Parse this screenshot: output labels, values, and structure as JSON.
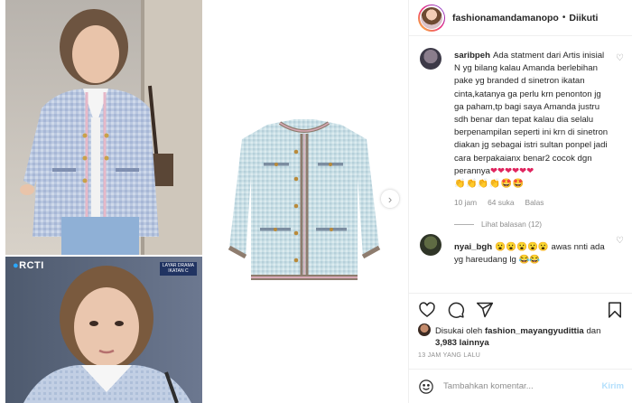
{
  "post": {
    "username": "fashionamandamanopo",
    "separator": "•",
    "follow_status": "Diikuti"
  },
  "media": {
    "channel_logo": "RCTI",
    "show_tag_line1": "LAYAR DRAMA",
    "show_tag_line2": "IKATAN C",
    "next_icon": "chevron-right-icon"
  },
  "comments": [
    {
      "username": "saribpeh",
      "text": "Ada statment dari Artis inisial N yg bilang kalau Amanda berlebihan pake yg branded d sinetron ikatan cinta,katanya ga perlu krn penonton jg ga paham,tp bagi saya Amanda justru sdh benar dan tepat kalau dia selalu berpenampilan seperti ini krn di sinetron diakan jg sebagai istri sultan ponpel jadi cara berpakaianx benar2 cocok dgn perannya",
      "hearts": "❤❤❤❤❤❤",
      "emojis": "👏👏👏👏🤩🤩",
      "time": "10 jam",
      "likes": "64 suka",
      "reply": "Balas",
      "view_replies": "Lihat balasan (12)"
    },
    {
      "username": "nyai_bgh",
      "text": "😮😮😮😮😮 awas nnti ada yg hareudang lg 😂😂"
    }
  ],
  "actions": {
    "like_icon": "heart-icon",
    "comment_icon": "comment-icon",
    "share_icon": "send-icon",
    "save_icon": "bookmark-icon"
  },
  "likes": {
    "prefix": "Disukai oleh",
    "user": "fashion_mayangyudittia",
    "conj": "dan",
    "count": "3,983 lainnya"
  },
  "timestamp": "13 JAM YANG LALU",
  "add_comment": {
    "placeholder": "Tambahkan komentar...",
    "send_label": "Kirim"
  }
}
